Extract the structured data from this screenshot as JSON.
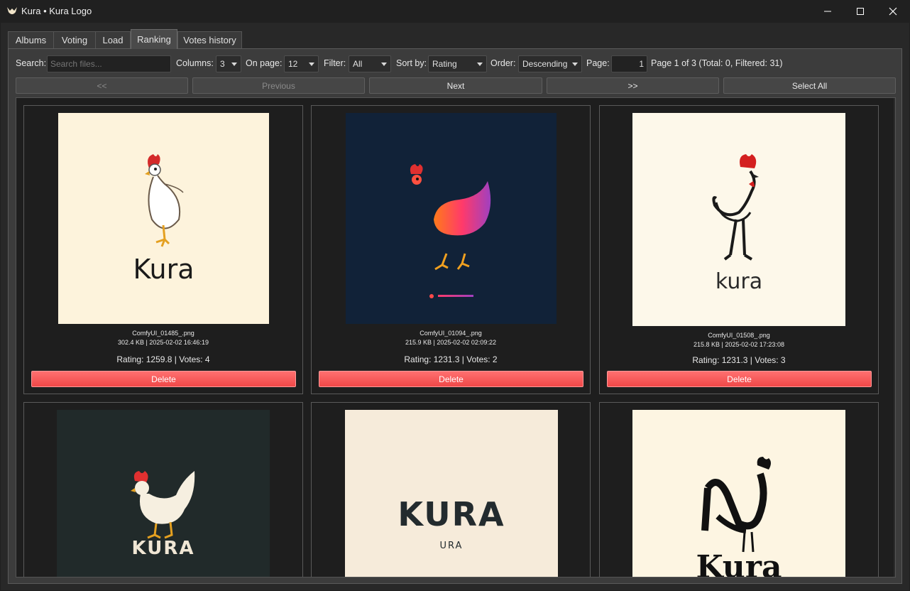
{
  "window": {
    "title": "Kura • Kura Logo"
  },
  "tabs": [
    "Albums",
    "Voting",
    "Load",
    "Ranking",
    "Votes history"
  ],
  "toolbar": {
    "search_label": "Search:",
    "search_placeholder": "Search files...",
    "columns_label": "Columns:",
    "columns_value": "3",
    "onpage_label": "On page:",
    "onpage_value": "12",
    "filter_label": "Filter:",
    "filter_value": "All",
    "sortby_label": "Sort by:",
    "sortby_value": "Rating",
    "order_label": "Order:",
    "order_value": "Descending",
    "page_label": "Page:",
    "page_value": "1",
    "page_info": "Page 1 of 3 (Total: 0, Filtered: 31)"
  },
  "nav": {
    "first": "<<",
    "previous": "Previous",
    "next": "Next",
    "last": ">>",
    "select_all": "Select All"
  },
  "cards": [
    {
      "filename": "ComfyUI_01485_.png",
      "meta": "302.4 KB | 2025-02-02 16:46:19",
      "rating": "Rating: 1259.8 | Votes: 4",
      "delete": "Delete",
      "logo_text": "Kura",
      "bg": "#fdf3dc"
    },
    {
      "filename": "ComfyUI_01094_.png",
      "meta": "215.9 KB | 2025-02-02 02:09:22",
      "rating": "Rating: 1231.3 | Votes: 2",
      "delete": "Delete",
      "logo_text": "",
      "bg": "#112238"
    },
    {
      "filename": "ComfyUI_01508_.png",
      "meta": "215.8 KB | 2025-02-02 17:23:08",
      "rating": "Rating: 1231.3 | Votes: 3",
      "delete": "Delete",
      "logo_text": "kura",
      "bg": "#fdf8ea"
    },
    {
      "filename": "",
      "meta": "",
      "rating": "",
      "delete": "",
      "logo_text": "KURA",
      "bg": "#212a2a"
    },
    {
      "filename": "",
      "meta": "",
      "rating": "",
      "delete": "",
      "logo_text": "KURA",
      "sub_text": "URA",
      "bg": "#f6ebda"
    },
    {
      "filename": "",
      "meta": "",
      "rating": "",
      "delete": "",
      "logo_text": "Kura",
      "bg": "#fdf5e2"
    }
  ]
}
